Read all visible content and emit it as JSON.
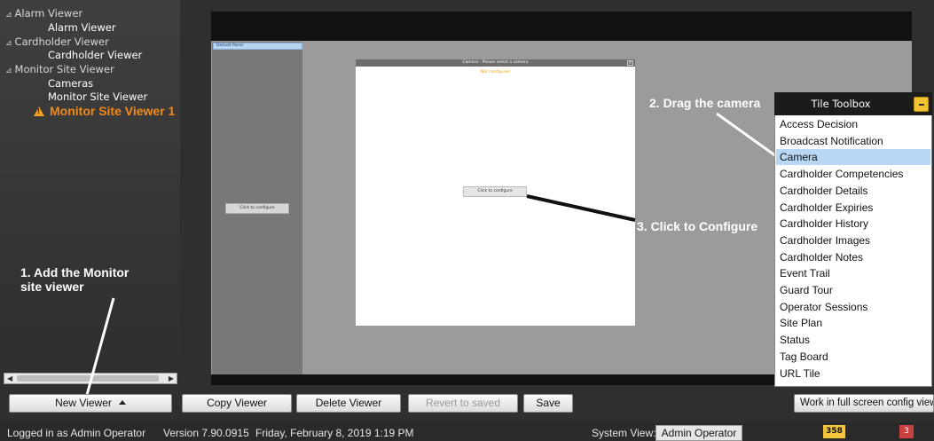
{
  "tree": {
    "items": [
      {
        "label": "Alarm Viewer",
        "expander": "⊿"
      },
      {
        "label": "Alarm Viewer"
      },
      {
        "label": "Cardholder Viewer",
        "expander": "⊿"
      },
      {
        "label": "Cardholder Viewer"
      },
      {
        "label": "Monitor Site Viewer",
        "expander": "⊿"
      },
      {
        "label": "Cameras"
      },
      {
        "label": "Monitor Site Viewer"
      },
      {
        "label": "Monitor Site Viewer 1"
      }
    ]
  },
  "canvas": {
    "tab_label": "Default Panel",
    "tile_config_label": "Click to configure",
    "camera_window": {
      "title": "Camera - Please select a camera",
      "subtitle": "Not configured",
      "config_label": "Click to configure"
    }
  },
  "annotations": {
    "step1_line1": "1. Add the Monitor",
    "step1_line2": "site viewer",
    "step2": "2. Drag the camera",
    "step3": "3. Click to Configure"
  },
  "toolbox": {
    "title": "Tile Toolbox",
    "items": [
      "Access Decision",
      "Broadcast Notification",
      "Camera",
      "Cardholder Competencies",
      "Cardholder Details",
      "Cardholder Expiries",
      "Cardholder History",
      "Cardholder Images",
      "Cardholder Notes",
      "Event Trail",
      "Guard Tour",
      "Operator Sessions",
      "Site Plan",
      "Status",
      "Tag Board",
      "URL Tile"
    ],
    "selected": "Camera"
  },
  "toolbar": {
    "new_viewer": "New Viewer",
    "copy_viewer": "Copy Viewer",
    "delete_viewer": "Delete Viewer",
    "revert": "Revert to saved",
    "save": "Save",
    "fullscreen": "Work in full screen config view"
  },
  "status": {
    "logged_in": "Logged in as Admin Operator",
    "version": "Version 7.90.0915",
    "datetime": "Friday, February 8, 2019 1:19 PM",
    "system_view_label": "System View:",
    "system_view_value": "Admin Operator",
    "badge_yellow": "358",
    "badge_red": "3"
  },
  "colors": {
    "accent_orange": "#f08a1c",
    "selection_blue": "#b7d7f5",
    "badge_yellow": "#f2c53d",
    "badge_red": "#c9423f"
  }
}
